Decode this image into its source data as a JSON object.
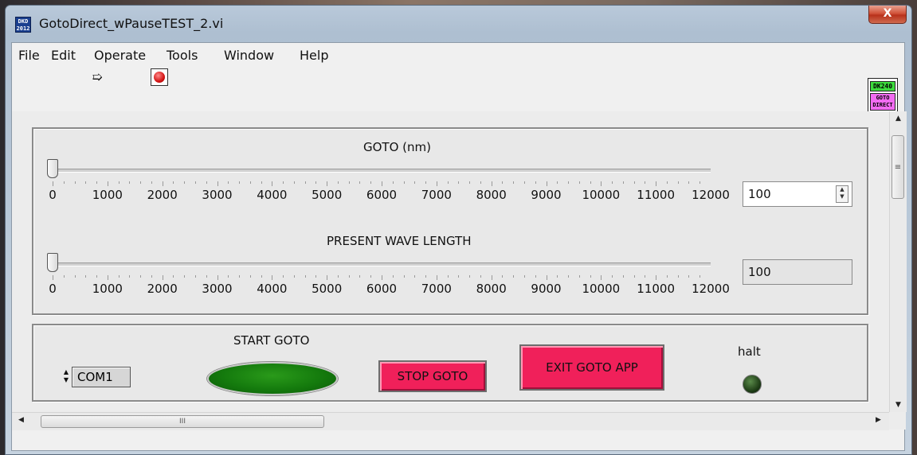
{
  "window": {
    "title": "GotoDirect_wPauseTEST_2.vi",
    "app_icon_text": "DKD 2012",
    "close_glyph": "X"
  },
  "menu": [
    "File",
    "Edit",
    "Operate",
    "Tools",
    "Window",
    "Help"
  ],
  "toolbar": {
    "run_glyph": "➯",
    "abort_icon": "abort-execution-icon"
  },
  "vi_icon": {
    "top_text": "DK240",
    "line1": "GOTO",
    "line2": "DIRECT"
  },
  "controls": {
    "goto": {
      "label": "GOTO (nm)",
      "value": "100",
      "scale": [
        "0",
        "1000",
        "2000",
        "3000",
        "4000",
        "5000",
        "6000",
        "7000",
        "8000",
        "9000",
        "10000",
        "11000",
        "12000"
      ]
    },
    "present": {
      "label": "PRESENT WAVE LENGTH",
      "value": "100",
      "scale": [
        "0",
        "1000",
        "2000",
        "3000",
        "4000",
        "5000",
        "6000",
        "7000",
        "8000",
        "9000",
        "10000",
        "11000",
        "12000"
      ]
    }
  },
  "actions": {
    "com_port": "COM1",
    "start_label": "START GOTO",
    "stop_label": "STOP GOTO",
    "exit_label": "EXIT  GOTO  APP",
    "halt_label": "halt"
  },
  "scroll": {
    "h_grip": "III",
    "v_grip": "≡"
  },
  "colors": {
    "led_off": "#1c3a14",
    "start_button": "#147a0d",
    "action_red": "#f0205a",
    "vi_icon_green": "#3ddc3d",
    "vi_icon_pink": "#f26bf2"
  }
}
